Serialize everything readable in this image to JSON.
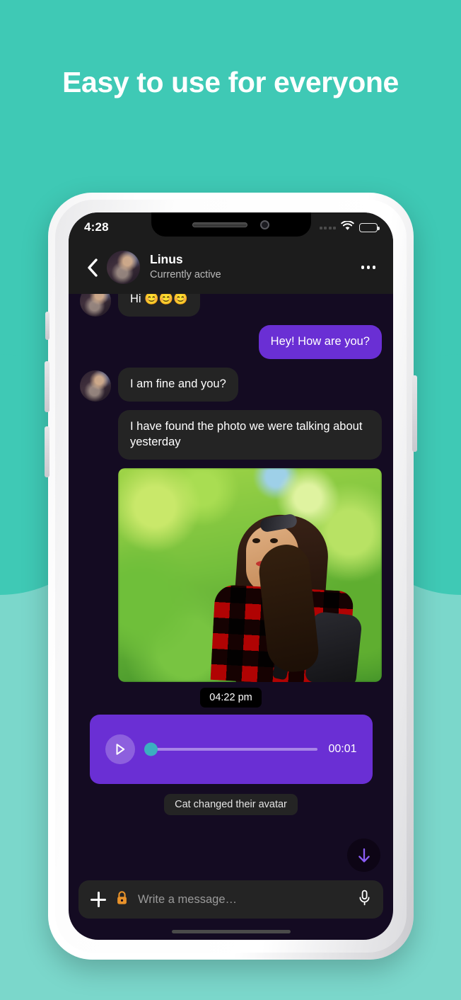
{
  "headline": "Easy to use for everyone",
  "theme": {
    "bg_teal_dark": "#3FC9B5",
    "bg_teal_light": "#7BD7CB",
    "accent_purple": "#6A2FD4",
    "bubble_incoming": "#242424",
    "chat_background": "#140B22",
    "slider_thumb_teal": "#3BAFC0",
    "lock_orange": "#E8922A"
  },
  "status_bar": {
    "time": "4:28",
    "icons": [
      "signal-dots-icon",
      "wifi-icon",
      "battery-icon"
    ]
  },
  "header": {
    "back_icon": "chevron-left-icon",
    "avatar": "contact-avatar",
    "name": "Linus",
    "status": "Currently active",
    "more_icon": "more-options-icon"
  },
  "messages": [
    {
      "id": "m1",
      "side": "in",
      "text": "Hi 😊😊😊",
      "avatar": true
    },
    {
      "id": "m2",
      "side": "out",
      "text": "Hey! How are you?",
      "avatar": false
    },
    {
      "id": "m3",
      "side": "in",
      "text": "I am fine and you?",
      "avatar": true
    },
    {
      "id": "m4",
      "side": "in",
      "text": "I have found the photo we were talking about yesterday",
      "avatar": false
    }
  ],
  "photo_message": {
    "alt": "photo of a woman in a red plaid shirt outdoors",
    "name": "photo-attachment"
  },
  "timestamp_chip": "04:22 pm",
  "voice_message": {
    "play_icon": "play-icon",
    "duration": "00:01",
    "progress_percent": 0
  },
  "system_message": "Cat changed their avatar",
  "scroll_fab": {
    "icon": "arrow-down-icon"
  },
  "input_bar": {
    "plus_icon": "plus-icon",
    "lock_icon": "lock-icon",
    "placeholder": "Write a message…",
    "value": "",
    "mic_icon": "microphone-icon"
  }
}
